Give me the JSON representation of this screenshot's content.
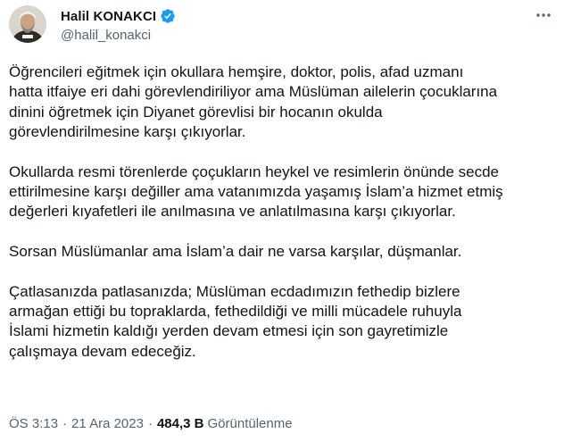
{
  "author": {
    "display_name": "Halil KONAKCI",
    "handle": "@halil_konakci",
    "verified": true,
    "verified_color": "#1d9bf0"
  },
  "icons": {
    "avatar": "profile-avatar",
    "verified": "verified-badge-icon",
    "more": "more-options-icon"
  },
  "tweet": {
    "paragraphs": [
      [
        "Öğrencileri eğitmek için okullara hemşire, doktor, polis, afad uzmanı",
        "hatta itfaiye eri dahi görevlendiriliyor ama Müslüman ailelerin çocuklarına",
        "dinini öğretmek için Diyanet görevlisi bir hocanın okulda",
        "görevlendirilmesine karşı çıkıyorlar."
      ],
      [
        "Okullarda resmi törenlerde çoçukların heykel ve resimlerin önünde secde",
        "ettirilmesine karşı değiller ama vatanımızda yaşamış İslam’a hizmet etmiş",
        "değerleri kıyafetleri ile anılmasına ve anlatılmasına karşı çıkıyorlar."
      ],
      [
        "Sorsan Müslümanlar ama İslam’a dair ne varsa karşılar, düşmanlar."
      ],
      [
        "Çatlasanızda patlasanızda; Müslüman ecdadımızın fethedip bizlere",
        "armağan ettiği bu topraklarda, fethedildiği ve milli mücadele ruhuyla",
        "İslami hizmetin kaldığı yerden devam etmesi için son gayretimizle",
        "çalışmaya devam edeceğiz."
      ]
    ]
  },
  "meta": {
    "time": "ÖS 3:13",
    "separator": "·",
    "date": "21 Ara 2023",
    "views_count": "484,3 B",
    "views_label": "Görüntülenme"
  }
}
